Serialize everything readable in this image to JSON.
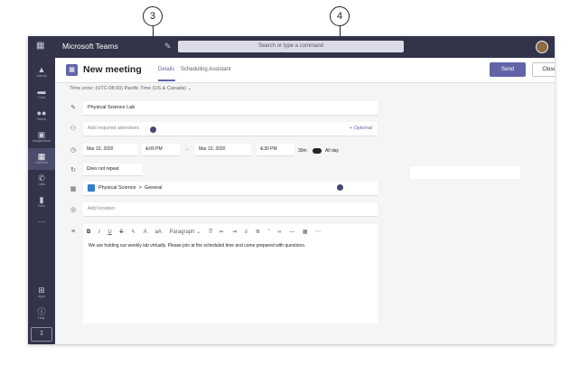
{
  "callouts": [
    {
      "number": "3"
    },
    {
      "number": "4"
    }
  ],
  "app": {
    "title": "Microsoft Teams",
    "search_placeholder": "Search or type a command"
  },
  "rail": [
    {
      "label": "Activity",
      "icon": "bell-icon"
    },
    {
      "label": "Chat",
      "icon": "chat-icon"
    },
    {
      "label": "Teams",
      "icon": "teams-icon"
    },
    {
      "label": "Assignments",
      "icon": "assignments-icon"
    },
    {
      "label": "Calendar",
      "icon": "calendar-icon"
    },
    {
      "label": "Calls",
      "icon": "phone-icon"
    },
    {
      "label": "Files",
      "icon": "file-icon"
    },
    {
      "label": "",
      "icon": "more-icon"
    },
    {
      "label": "Apps",
      "icon": "apps-icon"
    },
    {
      "label": "Help",
      "icon": "help-icon"
    }
  ],
  "header": {
    "title": "New meeting",
    "tabs": [
      "Details",
      "Scheduling Assistant"
    ],
    "send_label": "Send",
    "close_label": "Close"
  },
  "timezone": "Time zone: (UTC-08:00) Pacific Time (US & Canada)",
  "form": {
    "title_value": "Physical Science Lab",
    "attendees_placeholder": "Add required attendees",
    "optional_label": "+ Optional",
    "start_date": "Mar 10, 2020",
    "start_time": "4:00 PM",
    "end_date": "Mar 10, 2020",
    "end_time": "4:30 PM",
    "duration": "30m",
    "allday_label": "All day",
    "repeat_value": "Does not repeat",
    "channel_team": "Physical Science",
    "channel_sep": ">",
    "channel_name": "General",
    "location_placeholder": "Add location",
    "body_text": "We are holding our weekly lab virtually. Please join at the scheduled time and come prepared with questions."
  },
  "toolbar": {
    "bold": "B",
    "italic": "I",
    "underline": "U",
    "strike": "S",
    "paragraph": "Paragraph"
  },
  "colors": {
    "brand": "#6264a7",
    "rail": "#33344a"
  }
}
